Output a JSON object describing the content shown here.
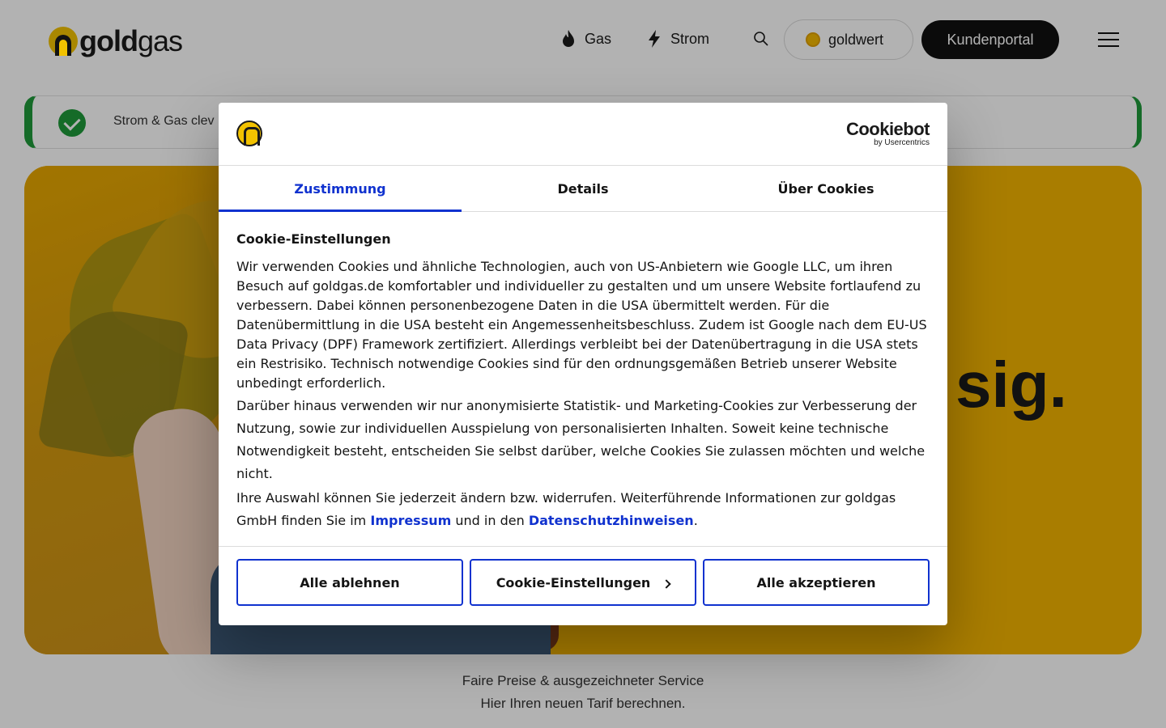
{
  "header": {
    "logo_bold": "gold",
    "logo_light": "gas",
    "nav_gas": "Gas",
    "nav_strom": "Strom",
    "goldwert": "goldwert",
    "kundenportal": "Kundenportal"
  },
  "notice": {
    "text": "Strom & Gas clev"
  },
  "hero": {
    "title_fragment": "sig."
  },
  "below_hero": {
    "line1": "Faire Preise & ausgezeichneter Service",
    "line2": "Hier Ihren neuen Tarif berechnen."
  },
  "dialog": {
    "brand": "Cookiebot",
    "brand_sub": "by Usercentrics",
    "tabs": [
      {
        "label": "Zustimmung",
        "active": true
      },
      {
        "label": "Details",
        "active": false
      },
      {
        "label": "Über Cookies",
        "active": false
      }
    ],
    "heading": "Cookie-Einstellungen",
    "paragraph1": "Wir verwenden Cookies und ähnliche Technologien, auch von US-Anbietern wie Google LLC, um ihren Besuch auf goldgas.de komfortabler und individueller zu gestalten und um unsere Website fortlaufend zu verbessern. Dabei können personenbezogene Daten in die USA übermittelt werden. Für die Datenübermittlung in die USA besteht ein Angemessenheitsbeschluss. Zudem ist Google nach dem EU-US Data Privacy (DPF) Framework zertifiziert. Allerdings verbleibt bei der Datenübertragung in die USA stets ein Restrisiko. Technisch notwendige Cookies sind für den ordnungsgemäßen Betrieb unserer Website unbedingt erforderlich.",
    "paragraph2": "Darüber hinaus verwenden wir nur anonymisierte Statistik- und Marketing-Cookies zur Verbesserung der Nutzung, sowie zur individuellen Ausspielung von personalisierten Inhalten. Soweit keine technische Notwendigkeit besteht, entscheiden Sie selbst darüber, welche Cookies Sie zulassen möchten und welche nicht.",
    "paragraph3_start": "Ihre Auswahl können Sie jederzeit ändern bzw. widerrufen. Weiterführende Informationen zur goldgas GmbH finden Sie im ",
    "link_impressum": "Impressum",
    "paragraph3_mid": " und in den ",
    "link_datenschutz": "Datenschutzhinweisen",
    "paragraph3_end": ".",
    "btn_reject": "Alle ablehnen",
    "btn_settings": "Cookie-Einstellungen",
    "btn_accept": "Alle akzeptieren"
  },
  "colors": {
    "accent_blue": "#1032cf",
    "gold": "#f2b400",
    "success_green": "#1f9a3a"
  }
}
